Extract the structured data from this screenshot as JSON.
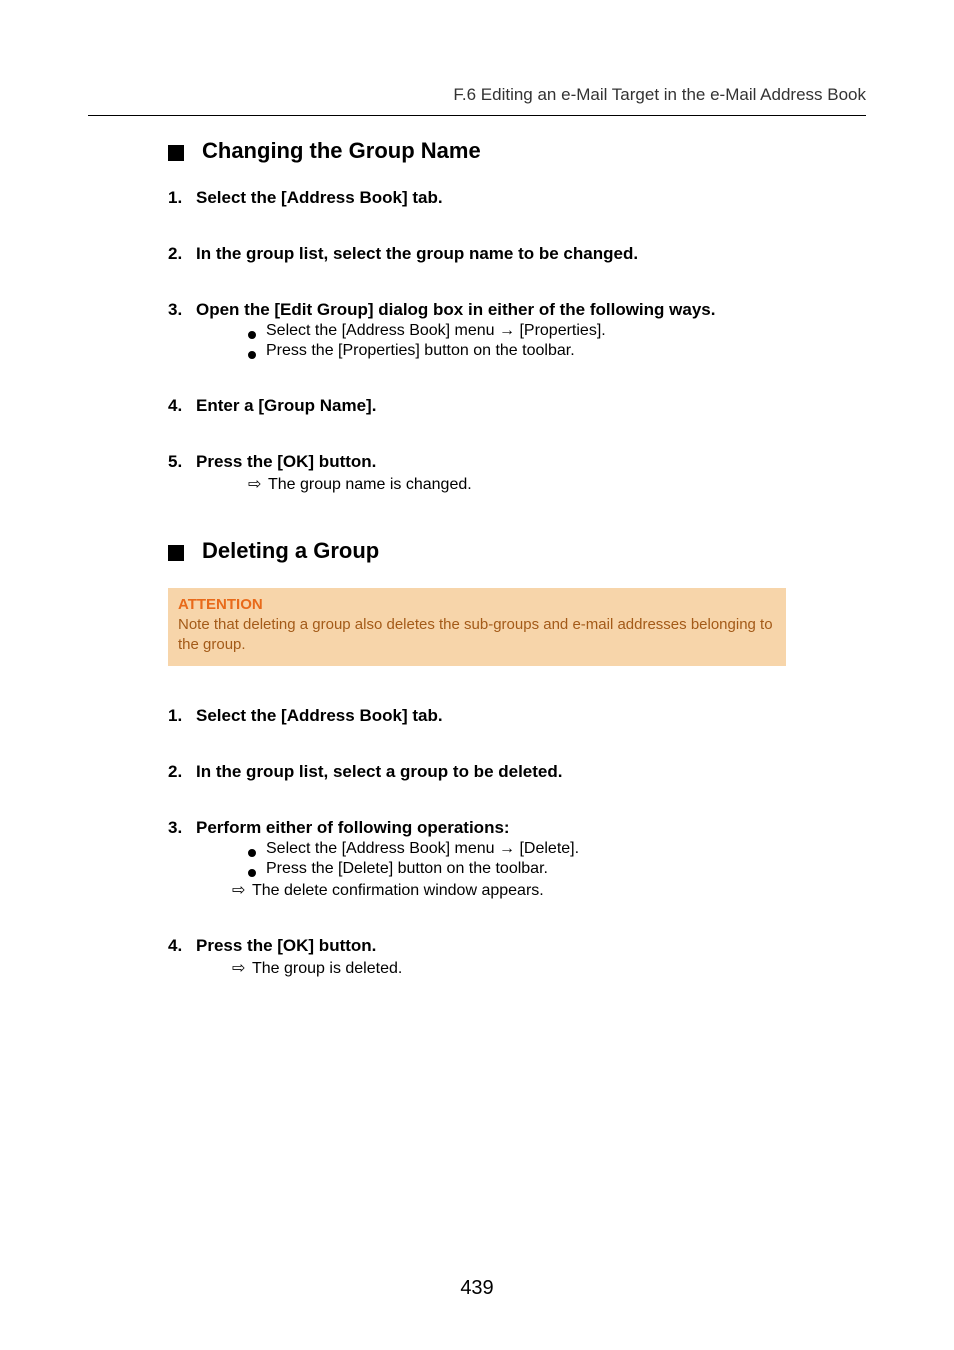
{
  "running_head": "F.6 Editing an e-Mail Target in the e-Mail Address Book",
  "section_change": {
    "title": "Changing the Group Name",
    "steps": {
      "s1": {
        "num": "1.",
        "text": "Select the [Address Book] tab."
      },
      "s2": {
        "num": "2.",
        "text": "In the group list, select the group name to be changed."
      },
      "s3": {
        "num": "3.",
        "text": "Open the [Edit Group] dialog box in either of the following ways.",
        "b1": "Select the [Address Book] menu → [Properties].",
        "b2": "Press the [Properties] button on the toolbar."
      },
      "s4": {
        "num": "4.",
        "text": "Enter a [Group Name]."
      },
      "s5": {
        "num": "5.",
        "text": "Press the [OK] button.",
        "r1": "The group name is changed."
      }
    }
  },
  "section_delete": {
    "title": "Deleting a Group",
    "attention": {
      "label": "ATTENTION",
      "body": "Note that deleting a group also deletes the sub-groups and e-mail addresses belonging to the group."
    },
    "steps": {
      "s1": {
        "num": "1.",
        "text": "Select the [Address Book] tab."
      },
      "s2": {
        "num": "2.",
        "text": "In the group list, select a group to be deleted."
      },
      "s3": {
        "num": "3.",
        "text": "Perform either of following operations:",
        "b1": "Select the [Address Book] menu → [Delete].",
        "b2": "Press the [Delete] button on the toolbar.",
        "r1": "The delete confirmation window appears."
      },
      "s4": {
        "num": "4.",
        "text": "Press the [OK] button.",
        "r1": "The group is deleted."
      }
    }
  },
  "page_number": "439",
  "glyphs": {
    "result_arrow": "⇨"
  }
}
